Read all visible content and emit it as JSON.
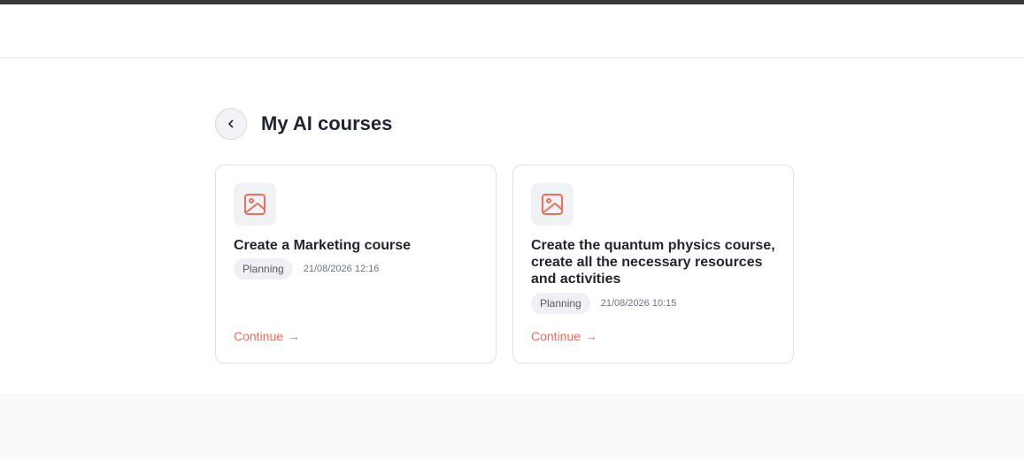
{
  "page": {
    "title": "My AI courses"
  },
  "colors": {
    "accent": "#e8705a",
    "topbar": "#383838",
    "footer_bg": "#f8f9fb"
  },
  "courses": [
    {
      "title": "Create a Marketing course",
      "status": "Planning",
      "timestamp": "21/08/2026 12:16",
      "action_label": "Continue",
      "action_icon": "arrow-right-icon",
      "thumbnail_icon": "image-icon"
    },
    {
      "title": "Create the quantum physics course, create all the necessary resources and activities",
      "status": "Planning",
      "timestamp": "21/08/2026 10:15",
      "action_label": "Continue",
      "action_icon": "arrow-right-icon",
      "thumbnail_icon": "image-icon"
    }
  ]
}
